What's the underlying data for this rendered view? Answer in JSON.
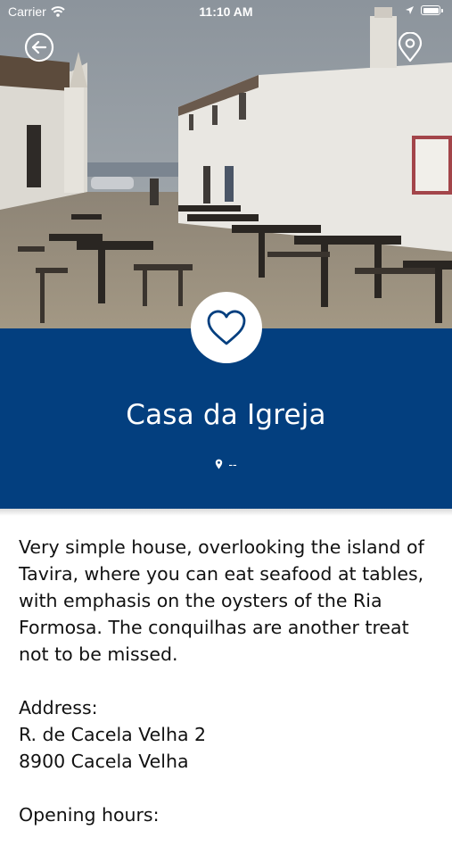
{
  "status_bar": {
    "carrier": "Carrier",
    "time": "11:10 AM"
  },
  "icons": {
    "back": "arrow-left-circle-icon",
    "map": "map-pin-icon",
    "favorite": "heart-outline-icon",
    "distance": "location-pin-icon",
    "wifi": "wifi-icon",
    "location_arrow": "location-arrow-icon",
    "battery": "battery-icon"
  },
  "colors": {
    "header_band": "#033f7f",
    "text": "#111111",
    "on_dark": "#ffffff"
  },
  "place": {
    "name": "Casa da Igreja",
    "distance": "--"
  },
  "details": {
    "description": "Very simple house, overlooking the island of Tavira, where you can eat seafood at tables, with emphasis on the oysters of the Ria Formosa. The conquilhas are another treat not to be missed.",
    "address_label": "Address:",
    "address_line1": "R. de Cacela Velha 2",
    "address_line2": "8900 Cacela Velha",
    "opening_hours_label": "Opening hours:"
  }
}
